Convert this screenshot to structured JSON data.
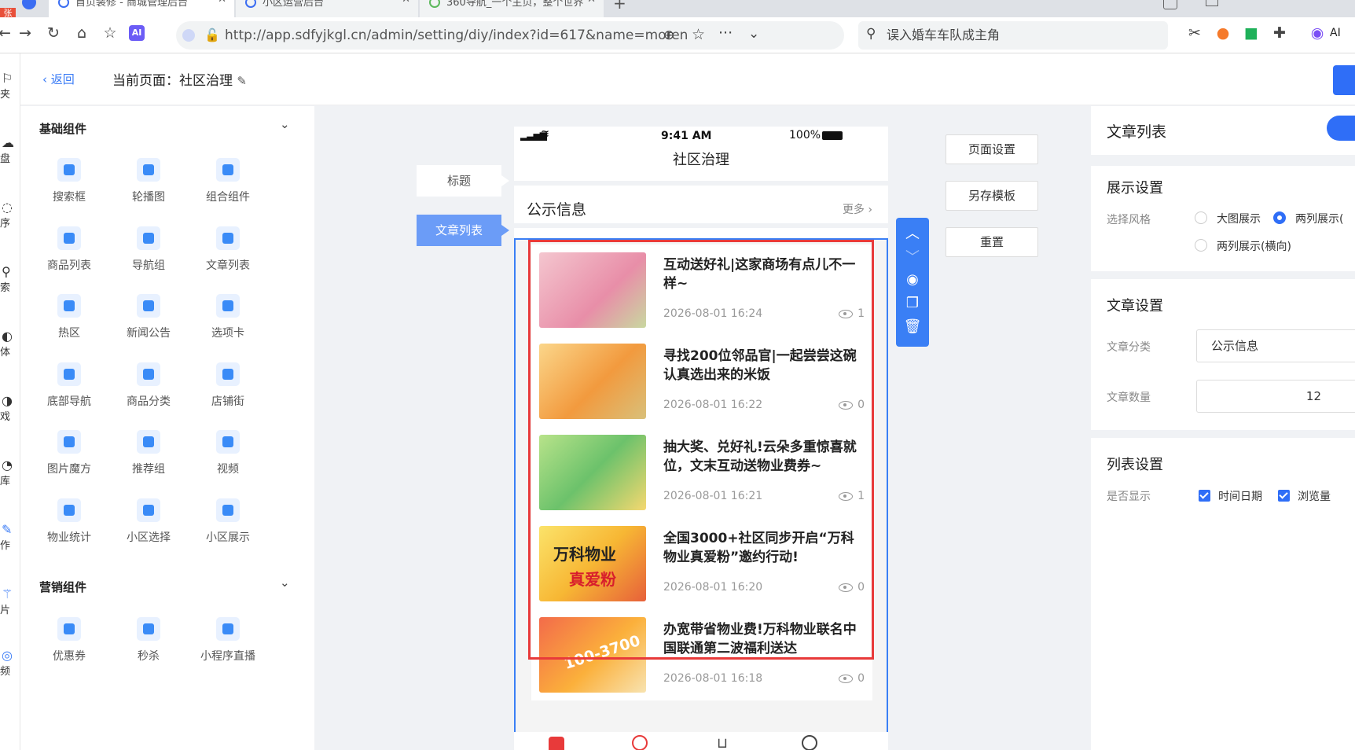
{
  "browser": {
    "tabs": [
      {
        "label": "首页装修 - 商城管理后台"
      },
      {
        "label": "小区运营后台"
      },
      {
        "label": "360导航_一个主页，整个世界"
      }
    ],
    "url": "http://app.sdfyjkgl.cn/admin/setting/diy/index?id=617&name=moren",
    "search_text": "误入婚车车队成主角",
    "ai_label": "AI"
  },
  "left_strip": [
    "夹",
    "盘",
    "序",
    "索",
    "体",
    "戏",
    "库",
    "作",
    "片",
    "频"
  ],
  "topbar": {
    "back_label": "返回",
    "current_page": "当前页面：社区治理"
  },
  "palette": {
    "basic_title": "基础组件",
    "basic_items": [
      "搜索框",
      "轮播图",
      "组合组件",
      "商品列表",
      "导航组",
      "文章列表",
      "热区",
      "新闻公告",
      "选项卡",
      "底部导航",
      "商品分类",
      "店铺街",
      "图片魔方",
      "推荐组",
      "视频",
      "物业统计",
      "小区选择",
      "小区展示"
    ],
    "marketing_title": "营销组件",
    "marketing_items": [
      "优惠券",
      "秒杀",
      "小程序直播"
    ]
  },
  "canvas": {
    "side_labels": [
      "标题",
      "文章列表"
    ],
    "page_buttons": [
      "页面设置",
      "另存模板",
      "重置"
    ]
  },
  "phone": {
    "time": "9:41 AM",
    "battery": "100%",
    "title": "社区治理",
    "notice_title": "公示信息",
    "notice_more": "更多",
    "articles": [
      {
        "title": "互动送好礼|这家商场有点儿不一样~",
        "date": "2026-08-01 16:24",
        "views": "1"
      },
      {
        "title": "寻找200位邻品官|一起尝尝这碗认真选出来的米饭",
        "date": "2026-08-01 16:22",
        "views": "0"
      },
      {
        "title": "抽大奖、兑好礼!云朵多重惊喜就位，文末互动送物业费券~",
        "date": "2026-08-01 16:21",
        "views": "1"
      },
      {
        "title": "全国3000+社区同步开启“万科物业真爱粉”邀约行动!",
        "date": "2026-08-01 16:20",
        "views": "0"
      },
      {
        "title": "办宽带省物业费!万科物业联名中国联通第二波福利送达",
        "date": "2026-08-01 16:18",
        "views": "0"
      }
    ],
    "thumb_texts": [
      "万科物业",
      "真爱粉",
      "100-3700"
    ]
  },
  "right_panel": {
    "title": "文章列表",
    "display_title": "展示设置",
    "style_label": "选择风格",
    "style_options": [
      "大图展示",
      "两列展示(",
      "两列展示(横向)"
    ],
    "article_title": "文章设置",
    "category_label": "文章分类",
    "category_value": "公示信息",
    "count_label": "文章数量",
    "count_value": "12",
    "list_title": "列表设置",
    "show_label": "是否显示",
    "show_options": [
      "时间日期",
      "浏览量"
    ]
  },
  "colors": {
    "accent": "#2f6ef7",
    "highlight": "#e83a3a"
  }
}
